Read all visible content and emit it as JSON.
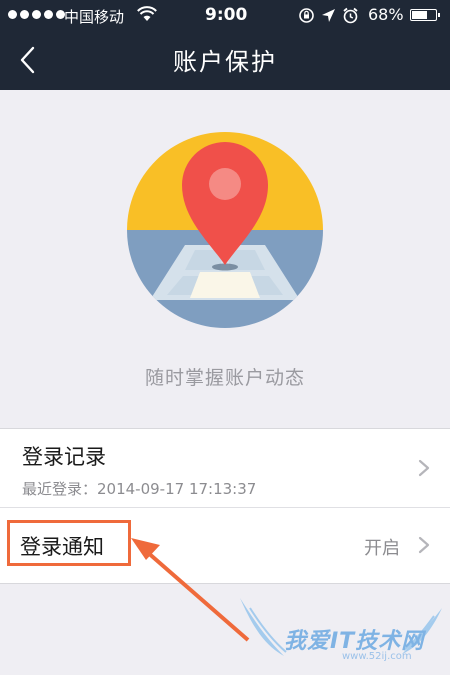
{
  "status_bar": {
    "carrier": "中国移动",
    "time": "9:00",
    "battery_percent": "68%",
    "battery_level": 0.68
  },
  "nav": {
    "title": "账户保护",
    "back_icon": "chevron-left-icon"
  },
  "hero": {
    "icon": "location-pin-sunset-icon",
    "tagline": "随时掌握账户动态"
  },
  "list": {
    "login_record": {
      "title": "登录记录",
      "last_login": "最近登录：2014-09-17 17:13:37"
    },
    "login_notice": {
      "title": "登录通知",
      "value": "开启"
    }
  },
  "watermark": {
    "text": "我爱IT技术网",
    "url": "www.52ij.com"
  },
  "colors": {
    "header_bg": "#1f2836",
    "page_bg": "#efeef3",
    "highlight": "#ef6a3b",
    "pin_red": "#f0504a",
    "sun_yellow": "#f9bf26",
    "water_blue": "#7f9ec0"
  }
}
